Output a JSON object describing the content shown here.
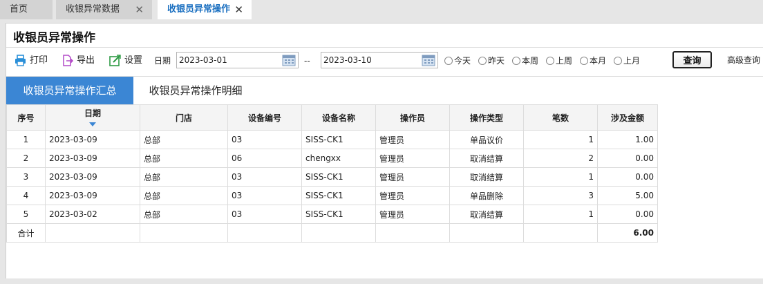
{
  "tabs": [
    {
      "label": "首页",
      "active": false,
      "closable": false
    },
    {
      "label": "收银异常数据",
      "active": false,
      "closable": true
    },
    {
      "label": "收银员异常操作",
      "active": true,
      "closable": true
    }
  ],
  "close_glyph": "✕",
  "page": {
    "title": "收银员异常操作"
  },
  "toolbar": {
    "print_label": "打印",
    "export_label": "导出",
    "settings_label": "设置",
    "date_label": "日期",
    "date_from": "2023-03-01",
    "date_sep": "--",
    "date_to": "2023-03-10",
    "quick_ranges": [
      "今天",
      "昨天",
      "本周",
      "上周",
      "本月",
      "上月"
    ],
    "query_label": "查询",
    "advanced_label": "高级查询"
  },
  "subtabs": {
    "summary": "收银员异常操作汇总",
    "detail": "收银员异常操作明细"
  },
  "table": {
    "columns": [
      "序号",
      "日期",
      "门店",
      "设备编号",
      "设备名称",
      "操作员",
      "操作类型",
      "笔数",
      "涉及金额"
    ],
    "rows": [
      [
        "1",
        "2023-03-09",
        "总部",
        "03",
        "SISS-CK1",
        "管理员",
        "单品议价",
        "1",
        "1.00"
      ],
      [
        "2",
        "2023-03-09",
        "总部",
        "06",
        "chengxx",
        "管理员",
        "取消结算",
        "2",
        "0.00"
      ],
      [
        "3",
        "2023-03-09",
        "总部",
        "03",
        "SISS-CK1",
        "管理员",
        "取消结算",
        "1",
        "0.00"
      ],
      [
        "4",
        "2023-03-09",
        "总部",
        "03",
        "SISS-CK1",
        "管理员",
        "单品删除",
        "3",
        "5.00"
      ],
      [
        "5",
        "2023-03-02",
        "总部",
        "03",
        "SISS-CK1",
        "管理员",
        "取消结算",
        "1",
        "0.00"
      ]
    ],
    "total": {
      "label": "合计",
      "amount": "6.00"
    }
  },
  "icons": {
    "print": "printer-icon",
    "export": "export-icon",
    "settings": "settings-icon",
    "calendar": "calendar-icon",
    "sort": "sort-desc-icon"
  },
  "colors": {
    "accent": "#3b86d4",
    "active_tab_text": "#1a6fc0",
    "print_icon": "#2a8fd8",
    "export_icon": "#b44cc8",
    "settings_icon": "#2e9b45"
  }
}
